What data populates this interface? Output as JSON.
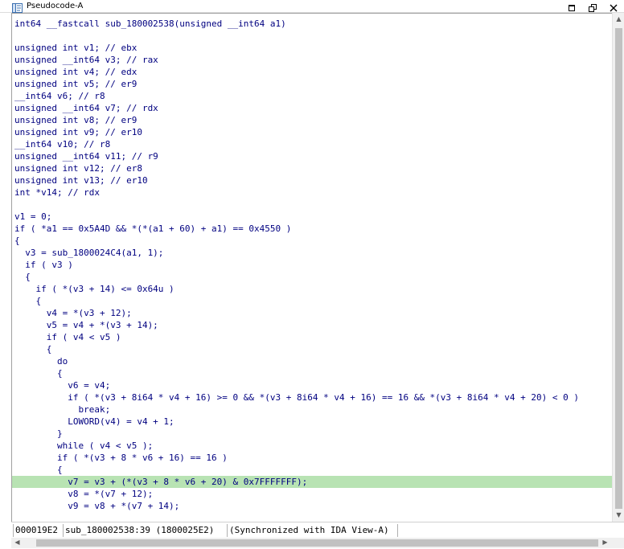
{
  "window": {
    "title": "Pseudocode-A"
  },
  "code_lines": [
    "int64 __fastcall sub_180002538(unsigned __int64 a1)",
    "",
    "unsigned int v1; // ebx",
    "unsigned __int64 v3; // rax",
    "unsigned int v4; // edx",
    "unsigned int v5; // er9",
    "__int64 v6; // r8",
    "unsigned __int64 v7; // rdx",
    "unsigned int v8; // er9",
    "unsigned int v9; // er10",
    "__int64 v10; // r8",
    "unsigned __int64 v11; // r9",
    "unsigned int v12; // er8",
    "unsigned int v13; // er10",
    "int *v14; // rdx",
    "",
    "v1 = 0;",
    "if ( *a1 == 0x5A4D && *(*(a1 + 60) + a1) == 0x4550 )",
    "{",
    "  v3 = sub_1800024C4(a1, 1);",
    "  if ( v3 )",
    "  {",
    "    if ( *(v3 + 14) <= 0x64u )",
    "    {",
    "      v4 = *(v3 + 12);",
    "      v5 = v4 + *(v3 + 14);",
    "      if ( v4 < v5 )",
    "      {",
    "        do",
    "        {",
    "          v6 = v4;",
    "          if ( *(v3 + 8i64 * v4 + 16) >= 0 && *(v3 + 8i64 * v4 + 16) == 16 && *(v3 + 8i64 * v4 + 20) < 0 )",
    "            break;",
    "          LOWORD(v4) = v4 + 1;",
    "        }",
    "        while ( v4 < v5 );",
    "        if ( *(v3 + 8 * v6 + 16) == 16 )",
    "        {",
    "          v7 = v3 + (*(v3 + 8 * v6 + 20) & 0x7FFFFFFF);",
    "          v8 = *(v7 + 12);",
    "          v9 = v8 + *(v7 + 14);"
  ],
  "highlighted_line": 38,
  "status": {
    "address": "000019E2",
    "location": "sub_180002538:39 (1800025E2)",
    "sync": "(Synchronized with IDA View-A)"
  },
  "colors": {
    "code_text": "#000080",
    "highlight": "#b8e3b3"
  },
  "icons": {
    "title": "pseudocode-document-icon",
    "minimize": "minimize-icon",
    "restore": "restore-icon",
    "close": "close-icon"
  }
}
